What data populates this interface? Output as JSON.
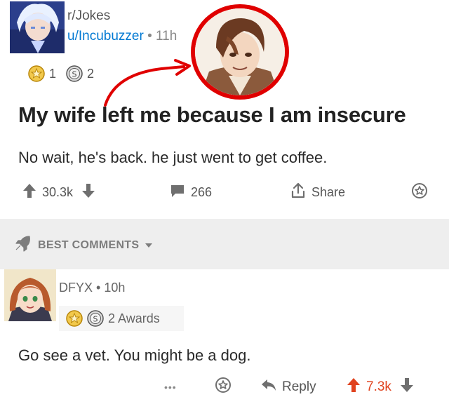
{
  "post": {
    "subreddit": "r/Jokes",
    "author": "u/Incubuzzer",
    "separator": "•",
    "time": "11h",
    "awards": [
      {
        "icon": "gold-award-icon",
        "count": "1"
      },
      {
        "icon": "silver-award-icon",
        "count": "2"
      }
    ],
    "title": "My wife left me because I am insecure",
    "body": "No wait,  he's back.  he just went to get coffee.",
    "upvotes": "30.3k",
    "comments": "266",
    "share_label": "Share"
  },
  "comments_section": {
    "sort_label": "BEST COMMENTS"
  },
  "comment": {
    "author": "DFYX",
    "separator": "•",
    "time": "10h",
    "awards_label": "2 Awards",
    "text": "Go see a vet. You might be a dog.",
    "more": "•••",
    "reply_label": "Reply",
    "votes": "7.3k"
  },
  "colors": {
    "link_blue": "#0079d3",
    "upvote_orange": "#e0431f",
    "overlay_red": "#e00000",
    "band_gray": "#eeeeee"
  }
}
